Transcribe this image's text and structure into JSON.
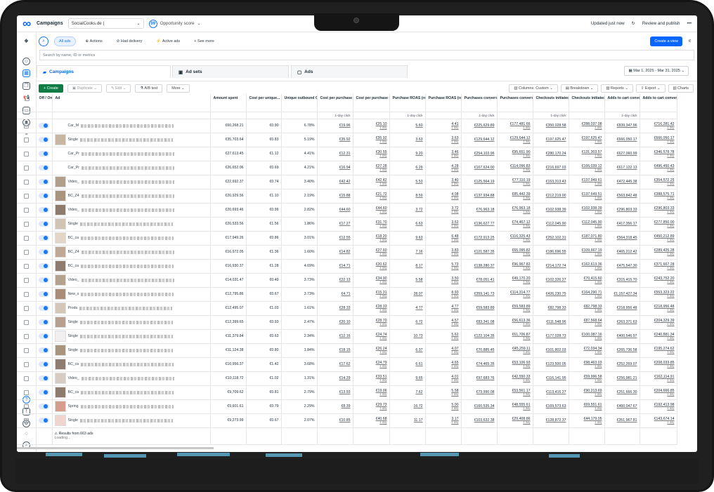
{
  "header": {
    "title": "Campaigns",
    "account": "SocialCooks.de (",
    "opportunity": "Opportunity score",
    "last_update": "Updated just now",
    "review": "Review and publish",
    "more": "•••"
  },
  "filters": {
    "all_ads": "All ads",
    "actions": "Actions",
    "delivery": "Had delivery",
    "active": "Active ads",
    "see_more": "See more",
    "create_view": "Create a view"
  },
  "search": {
    "placeholder": "Search by name, ID or metrics"
  },
  "tabs": [
    {
      "label": "Campaigns"
    },
    {
      "label": "Ad sets"
    },
    {
      "label": "Ads"
    }
  ],
  "date_range": "Mar 1, 2025 - Mar 31, 2025",
  "toolbar": {
    "create": "Create",
    "duplicate": "Duplicate",
    "edit": "Edit",
    "ab_test": "A/B test",
    "more": "More",
    "columns": "Columns: Custom",
    "breakdown": "Breakdown",
    "reports": "Reports",
    "export": "Export",
    "charts": "Charts"
  },
  "columns": [
    "Off / On",
    "Ad",
    "Amount spent",
    "Cost per unique...",
    "Unique outbound C...",
    "Cost per purchase",
    "Cost per purchase by...",
    "Purchase ROAS (retur...",
    "Purchase ROAS (retur...",
    "Purchases conversion...",
    "Purchases conversion...",
    "Checkouts initiated...",
    "Checkouts initiated...",
    "Adds to cart conversion...",
    "Adds to cart conversion..."
  ],
  "attribution": "1-day click",
  "day": "1 day",
  "rows": [
    [
      "Car_M",
      "€60,268.21",
      "€0.90",
      "6.78%",
      "€19.96",
      "€25.10",
      "5.60",
      "4.41",
      "€225,629.89",
      "€177,481.66",
      "€350,028.58",
      "€288,037.08",
      "€839,347.96",
      "€716,281.42"
    ],
    [
      "Single",
      "€35,703.64",
      "€0.83",
      "5.19%",
      "€35.92",
      "€35.92",
      "3.63",
      "3.63",
      "€129,644.12",
      "€129,644.12",
      "€197,625.47",
      "€197,625.47",
      "€666,050.17",
      "€666,050.17"
    ],
    [
      "Car_Pr",
      "€27,613.45",
      "€1.12",
      "4.41%",
      "€12.31",
      "€30.55",
      "9.20",
      "3.46",
      "€254,103.96",
      "€95,651.90",
      "€280,170.24",
      "€131,303.57",
      "€627,060.99",
      "€346,578.78"
    ],
    [
      "Car_Pr",
      "€26,652.06",
      "€0.69",
      "4.21%",
      "€16.94",
      "€27.28",
      "6.29",
      "4.28",
      "€167,624.00",
      "€114,096.83",
      "€216,697.03",
      "€166,039.12",
      "€617,122.13",
      "€496,450.43"
    ],
    [
      "Video_",
      "€22,692.37",
      "€0.74",
      "3.40%",
      "€42.42",
      "€42.42",
      "5.53",
      "3.40",
      "€125,564.19",
      "€77,110.19",
      "€153,313.43",
      "€137,949.61",
      "€472,445.38",
      "€354,572.25"
    ],
    [
      "BC_Z4",
      "€20,929.56",
      "€1.10",
      "2.19%",
      "€15.88",
      "€21.72",
      "8.59",
      "4.08",
      "€137,934.88",
      "€85,442.39",
      "€212,219.00",
      "€137,649.51",
      "€563,842.48",
      "€388,575.71"
    ],
    [
      "Video_",
      "€20,693.46",
      "€0.99",
      "2.82%",
      "€44.60",
      "€44.60",
      "3.72",
      "3.72",
      "€76,963.18",
      "€76,963.18",
      "€102,938.39",
      "€102,938.39",
      "€296,803.33",
      "€296,803.33"
    ],
    [
      "Single",
      "€20,533.56",
      "€1.56",
      "1.86%",
      "€17.27",
      "€31.70",
      "6.63",
      "3.62",
      "€136,627.77",
      "€74,467.12",
      "€112,045.90",
      "€112,045.90",
      "€417,356.17",
      "€277,850.00"
    ],
    [
      "BC_ca",
      "€17,949.26",
      "€0.86",
      "3.01%",
      "€12.55",
      "€18.20",
      "9.63",
      "6.48",
      "€172,913.25",
      "€116,325.43",
      "€252,102.31",
      "€187,071.80",
      "€564,318.45",
      "€450,212.89"
    ],
    [
      "BC_Z4",
      "€16,972.05",
      "€1.36",
      "1.60%",
      "€14.82",
      "€27.60",
      "7.16",
      "3.83",
      "€121,587.35",
      "€65,095.82",
      "€186,696.55",
      "€109,667.19",
      "€465,212.42",
      "€289,425.28"
    ],
    [
      "BC_ca",
      "€16,930.37",
      "€1.28",
      "4.69%",
      "€14.71",
      "€20.62",
      "8.17",
      "5.73",
      "€138,280.37",
      "€96,967.82",
      "€214,172.74",
      "€162,613.36",
      "€475,547.30",
      "€371,667.28"
    ],
    [
      "Video_",
      "€14,031.47",
      "€0.49",
      "3.73%",
      "€22.13",
      "€34.90",
      "5.58",
      "3.50",
      "€78,051.41",
      "€49,170.20",
      "€102,326.27",
      "€70,415.60",
      "€315,415.70",
      "€243,752.20"
    ],
    [
      "New_s",
      "€12,795.86",
      "€0.67",
      "3.73%",
      "€4.71",
      "€15.31",
      "28.07",
      "8.93",
      "€359,141.73",
      "€114,314.77",
      "€426,230.75",
      "€164,290.71",
      "€1,157,427.34",
      "€553,323.22"
    ],
    [
      "Produ",
      "€12,495.07",
      "€1.03",
      "1.61%",
      "€28.33",
      "€28.33",
      "4.77",
      "4.77",
      "€59,583.89",
      "€59,583.89",
      "€82,798.33",
      "€82,798.33",
      "€218,956.48",
      "€218,956.48"
    ],
    [
      "Single",
      "€12,399.65",
      "€0.93",
      "2.47%",
      "€20.10",
      "€28.70",
      "6.72",
      "4.57",
      "€83,341.08",
      "€56,613.36",
      "€111,548.96",
      "€87,568.64",
      "€263,371.63",
      "€204,329.39"
    ],
    [
      "Single",
      "€11,379.84",
      "€0.63",
      "2.34%",
      "€12.16",
      "€24.74",
      "10.73",
      "5.62",
      "€122,104.35",
      "€61,706.87",
      "€177,028.73",
      "€100,087.16",
      "€400,546.97",
      "€240,881.34"
    ],
    [
      "Single",
      "€11,124.38",
      "€0.80",
      "1.84%",
      "€18.15",
      "€26.24",
      "6.37",
      "4.07",
      "€70,885.45",
      "€45,259.11",
      "€101,802.03",
      "€72,034.34",
      "€265,736.58",
      "€195,274.62"
    ],
    [
      "BC_ca",
      "€10,956.37",
      "€1.42",
      "3.68%",
      "€17.62",
      "€24.79",
      "6.61",
      "4.65",
      "€74,465.35",
      "€53,106.93",
      "€123,500.05",
      "€98,463.03",
      "€252,269.07",
      "€208,033.85"
    ],
    [
      "Video_",
      "€10,118.72",
      "€1.02",
      "1.31%",
      "€14.29",
      "€33.51",
      "9.65",
      "4.01",
      "€97,683.76",
      "€42,550.33",
      "€116,141.95",
      "€59,996.58",
      "€256,981.21",
      "€162,114.91"
    ],
    [
      "BC_ca",
      "€9,709.62",
      "€0.81",
      "2.79%",
      "€13.93",
      "€19.06",
      "7.62",
      "5.58",
      "€73,990.08",
      "€53,561.17",
      "€113,416.27",
      "€90,213.69",
      "€251,666.30",
      "€204,666.85"
    ],
    [
      "Spring",
      "€9,601.61",
      "€0.79",
      "2.29%",
      "€8.39",
      "€29.73",
      "16.72",
      "5.00",
      "€160,535.34",
      "€48,555.61",
      "€169,573.63",
      "€69,551.61",
      "€460,047.67",
      "€192,413.98"
    ],
    [
      "Single",
      "€9,273.99",
      "€0.67",
      "2.07%",
      "€10.85",
      "€40.68",
      "11.17",
      "3.17",
      "€103,632.38",
      "€29,408.86",
      "€128,872.37",
      "€44,179.05",
      "€351,967.81",
      "€143,674.14"
    ]
  ],
  "footer": {
    "results": "Results from 663 ads",
    "loading": "Loading..."
  }
}
